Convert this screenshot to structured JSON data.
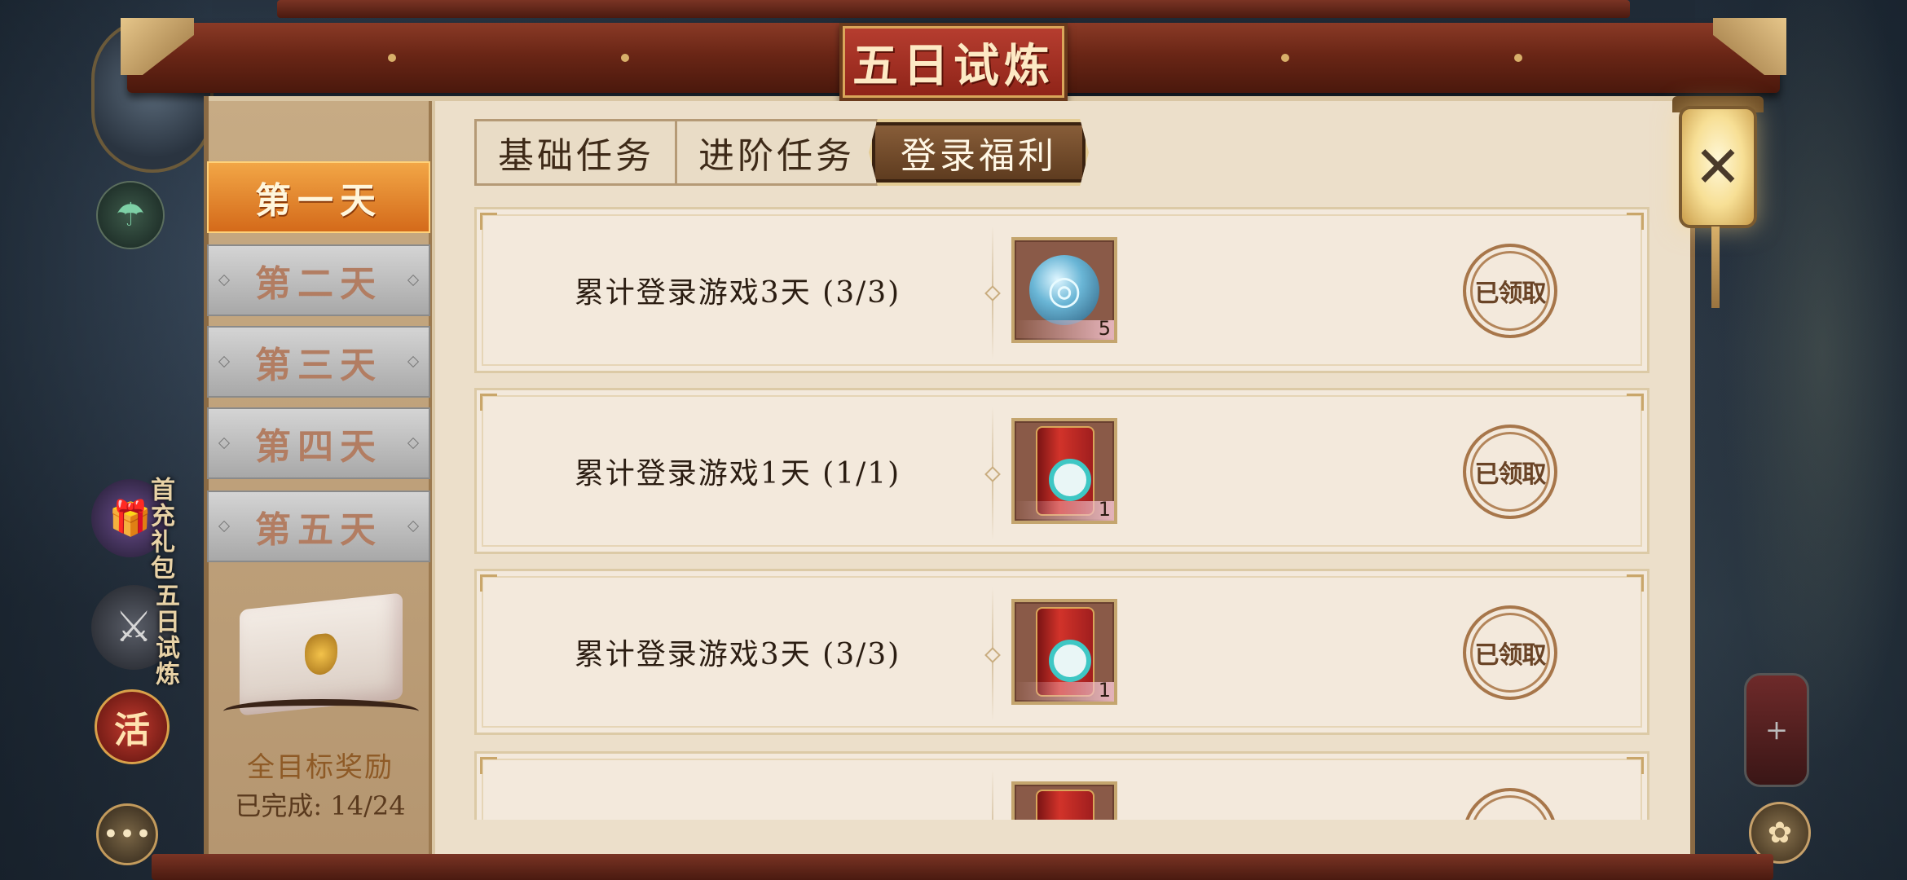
{
  "header": {
    "title": "五日试炼"
  },
  "close_button": {
    "icon": "close-icon"
  },
  "day_tabs": [
    {
      "label": "第一天",
      "active": true
    },
    {
      "label": "第二天",
      "active": false
    },
    {
      "label": "第三天",
      "active": false
    },
    {
      "label": "第四天",
      "active": false
    },
    {
      "label": "第五天",
      "active": false
    }
  ],
  "reward": {
    "title": "全目标奖励",
    "progress": "已完成: 14/24"
  },
  "task_tabs": [
    {
      "label": "基础任务",
      "active": false
    },
    {
      "label": "进阶任务",
      "active": false
    },
    {
      "label": "登录福利",
      "active": true
    }
  ],
  "tasks": [
    {
      "text": "累计登录游戏3天 (3/3)",
      "item_icon": "jade-orb-icon",
      "item_count": "5",
      "status": "已领取"
    },
    {
      "text": "累计登录游戏1天 (1/1)",
      "item_icon": "red-scroll-icon",
      "item_count": "1",
      "status": "已领取"
    },
    {
      "text": "累计登录游戏3天 (3/3)",
      "item_icon": "red-scroll-icon",
      "item_count": "1",
      "status": "已领取"
    }
  ],
  "side_icons": {
    "gift_label": "首充礼包",
    "trial_label": "五日试炼",
    "activity_glyph": "活"
  },
  "colors": {
    "active_day_tab": "#e0822a",
    "inactive_day_tab": "#bdbdbd",
    "active_task_tab": "#6e4a2a",
    "title_plaque": "#a3302a",
    "panel_bg": "#ecdfca"
  }
}
